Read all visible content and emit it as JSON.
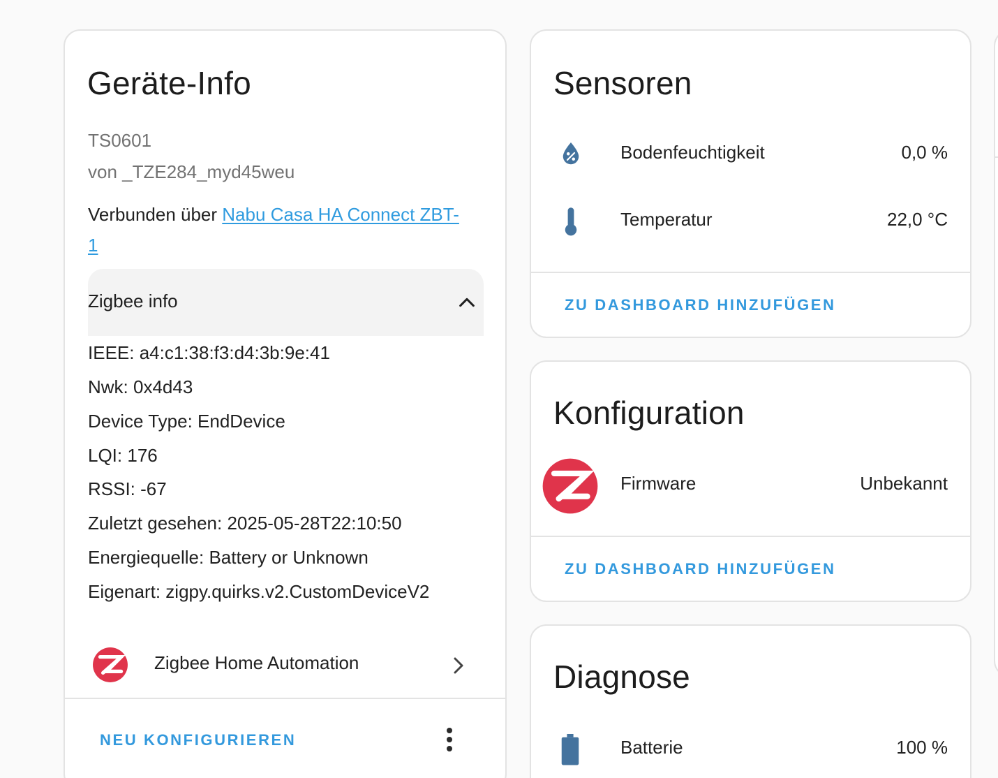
{
  "device_info": {
    "title": "Geräte-Info",
    "model": "TS0601",
    "manufacturer": "von _TZE284_myd45weu",
    "connected_via_prefix": "Verbunden über ",
    "connected_via_link_line1": "Nabu Casa HA Connect ZBT-",
    "connected_via_link_line2": "1",
    "zigbee_info": {
      "header": "Zigbee info",
      "lines": [
        "IEEE: a4:c1:38:f3:d4:3b:9e:41",
        "Nwk: 0x4d43",
        "Device Type: EndDevice",
        "LQI: 176",
        "RSSI: -67",
        "Zuletzt gesehen: 2025-05-28T22:10:50",
        "Energiequelle: Battery or Unknown",
        "Eigenart: zigpy.quirks.v2.CustomDeviceV2"
      ]
    },
    "integration": {
      "label": "Zigbee Home Automation",
      "icon": "zigbee-logo-icon"
    },
    "reconfigure_label": "NEU KONFIGURIEREN"
  },
  "sensors": {
    "title": "Sensoren",
    "items": [
      {
        "name": "Bodenfeuchtigkeit",
        "value": "0,0 %",
        "icon": "water-percent-icon"
      },
      {
        "name": "Temperatur",
        "value": "22,0 °C",
        "icon": "thermometer-icon"
      }
    ],
    "add_label": "ZU DASHBOARD HINZUFÜGEN"
  },
  "configuration": {
    "title": "Konfiguration",
    "items": [
      {
        "name": "Firmware",
        "value": "Unbekannt",
        "icon": "zigbee-logo-icon"
      }
    ],
    "add_label": "ZU DASHBOARD HINZUFÜGEN"
  },
  "diagnostics": {
    "title": "Diagnose",
    "items": [
      {
        "name": "Batterie",
        "value": "100 %",
        "icon": "battery-icon"
      }
    ]
  },
  "colors": {
    "accent": "#3399dd",
    "link": "#2f9bdf",
    "icon": "#44739e",
    "zigbee_red": "#e0344b"
  }
}
